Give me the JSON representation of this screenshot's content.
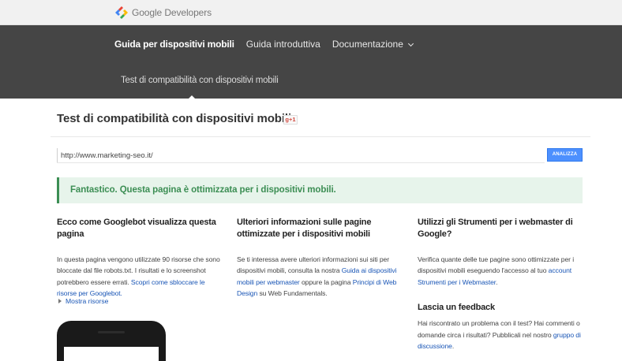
{
  "header": {
    "brand": "Google Developers",
    "logo_colors": [
      "#4285f4",
      "#ea4335",
      "#fbbc05",
      "#34a853"
    ]
  },
  "nav": {
    "items": [
      {
        "label": "Guida per dispositivi mobili"
      },
      {
        "label": "Guida introduttiva"
      },
      {
        "label": "Documentazione"
      }
    ],
    "subnav": "Test di compatibilità con dispositivi mobili"
  },
  "main": {
    "title": "Test di compatibilità con dispositivi mobili",
    "gplus_label": "g+1",
    "url_value": "http://www.marketing-seo.it/",
    "analyze_label": "ANALIZZA",
    "result": "Fantastico. Questa pagina è ottimizzata per i dispositivi mobili.",
    "accent_color": "#4d90fe",
    "success_color": "#3c8e54"
  },
  "col1": {
    "heading": "Ecco come Googlebot visualizza questa pagina",
    "text": "In questa pagina vengono utilizzate 90 risorse che sono bloccate dal file robots.txt. I risultati e lo screenshot potrebbero essere errati. ",
    "link": "Scopri come sbloccare le risorse per Googlebot.",
    "show_resources": "Mostra risorse"
  },
  "col2": {
    "heading": "Ulteriori informazioni sulle pagine ottimizzate per i dispositivi mobili",
    "text1": "Se ti interessa avere ulteriori informazioni sui siti per dispositivi mobili, consulta la nostra ",
    "link1": "Guida ai dispositivi mobili per webmaster",
    "text2": " oppure la pagina ",
    "link2": "Principi di Web Design",
    "text3": " su Web Fundamentals."
  },
  "col3": {
    "heading": "Utilizzi gli Strumenti per i webmaster di Google?",
    "text1": "Verifica quante delle tue pagine sono ottimizzate per i dispositivi mobili eseguendo l'accesso al tuo ",
    "link1": "account Strumenti per i Webmaster",
    "text2": ".",
    "feedback_heading": "Lascia un feedback",
    "feedback_text": "Hai riscontrato un problema con il test? Hai commenti o domande circa i risultati? Pubblicali nel nostro ",
    "feedback_link": "gruppo di discussione",
    "feedback_end": "."
  }
}
